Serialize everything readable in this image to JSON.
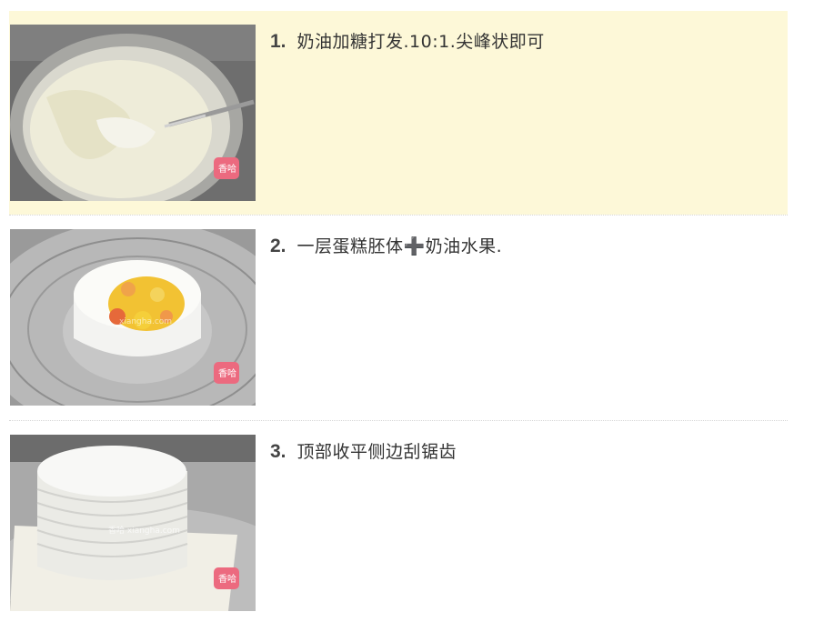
{
  "steps": [
    {
      "number": "1.",
      "text": "奶油加糖打发.10:1.尖峰状即可",
      "image_label": "whipped-cream-bowl",
      "badge": "香哈"
    },
    {
      "number": "2.",
      "text": "一层蛋糕胚体➕奶油水果.",
      "image_label": "cake-layer-with-fruit",
      "badge": "香哈",
      "watermark": "xiangha.com"
    },
    {
      "number": "3.",
      "text": "顶部收平侧边刮锯齿",
      "image_label": "frosted-cake-with-serrated-sides",
      "badge": "香哈",
      "watermark": "香哈 xiangha.com"
    }
  ]
}
